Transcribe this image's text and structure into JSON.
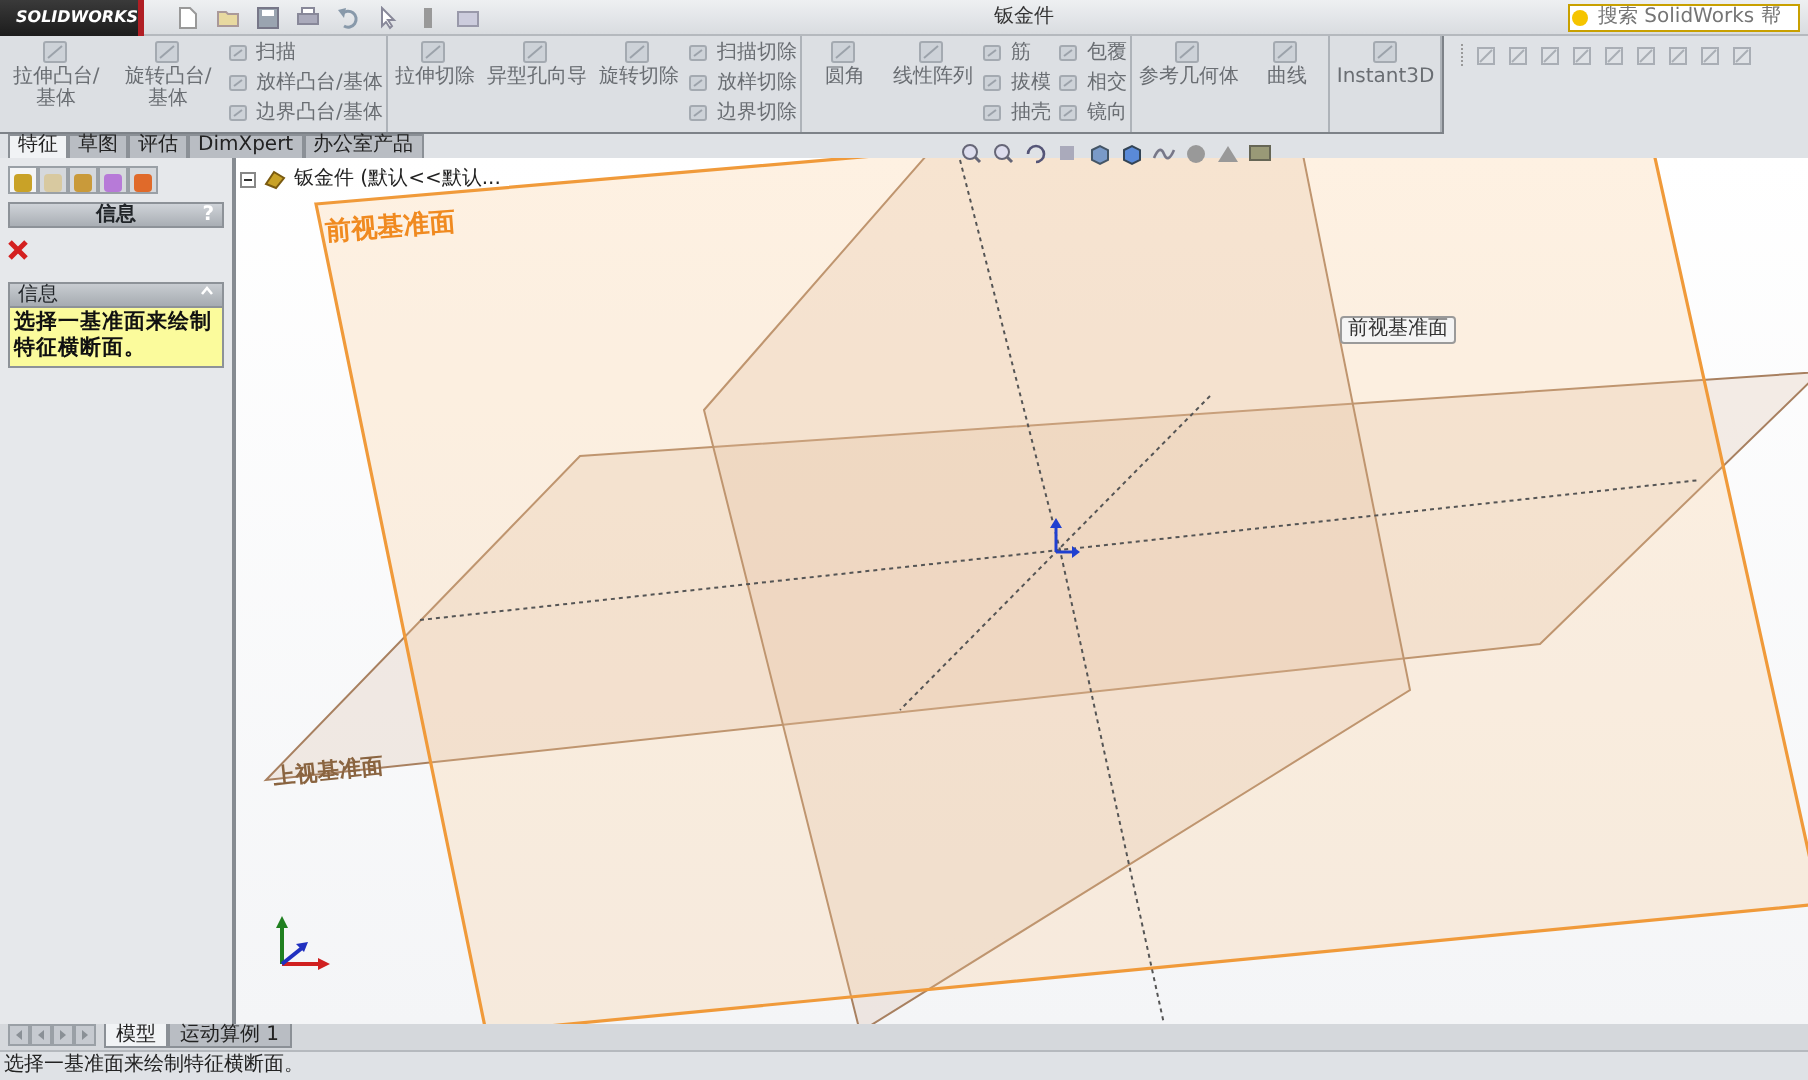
{
  "title_bar": {
    "logo": "SOLIDWORKS",
    "title": "钣金件",
    "search_placeholder": "搜索 SolidWorks 帮"
  },
  "ribbon": {
    "groups": [
      {
        "items": [
          {
            "label": "拉伸凸台/基体",
            "kind": "large"
          },
          {
            "label": "旋转凸台/基体",
            "kind": "large"
          },
          {
            "label": "扫描",
            "kind": "small"
          },
          {
            "label": "放样凸台/基体",
            "kind": "small"
          },
          {
            "label": "边界凸台/基体",
            "kind": "small"
          }
        ]
      },
      {
        "items": [
          {
            "label": "拉伸切除",
            "kind": "large"
          },
          {
            "label": "异型孔向导",
            "kind": "large"
          },
          {
            "label": "旋转切除",
            "kind": "large"
          },
          {
            "label": "扫描切除",
            "kind": "small"
          },
          {
            "label": "放样切除",
            "kind": "small"
          },
          {
            "label": "边界切除",
            "kind": "small"
          }
        ]
      },
      {
        "items": [
          {
            "label": "圆角",
            "kind": "large"
          },
          {
            "label": "线性阵列",
            "kind": "large"
          },
          {
            "label": "筋",
            "kind": "small"
          },
          {
            "label": "拔模",
            "kind": "small"
          },
          {
            "label": "抽壳",
            "kind": "small"
          },
          {
            "label": "包覆",
            "kind": "small"
          },
          {
            "label": "相交",
            "kind": "small"
          },
          {
            "label": "镜向",
            "kind": "small"
          }
        ]
      },
      {
        "items": [
          {
            "label": "参考几何体",
            "kind": "large"
          },
          {
            "label": "曲线",
            "kind": "large"
          }
        ]
      },
      {
        "items": [
          {
            "label": "Instant3D",
            "kind": "large"
          }
        ]
      }
    ]
  },
  "command_tabs": [
    {
      "label": "特征",
      "selected": true
    },
    {
      "label": "草图",
      "selected": false
    },
    {
      "label": "评估",
      "selected": false
    },
    {
      "label": "DimXpert",
      "selected": false
    },
    {
      "label": "办公室产品",
      "selected": false
    }
  ],
  "panel_tabs": [
    {
      "selected": true
    },
    {
      "selected": false
    },
    {
      "selected": false
    },
    {
      "selected": false
    },
    {
      "selected": false
    }
  ],
  "property_manager": {
    "title": "信息",
    "help": "?",
    "section": {
      "title": "信息",
      "message": "选择一基准面来绘制特征横断面。"
    }
  },
  "viewport": {
    "tree_root": "钣金件 (默认<<默认...",
    "tooltip": "前视基准面",
    "planes": [
      {
        "kind": "front",
        "label": "前视基准面",
        "highlighted": true
      },
      {
        "kind": "top",
        "label": "上视基准面",
        "highlighted": false
      },
      {
        "kind": "right",
        "highlighted": false
      }
    ]
  },
  "bottom_tabs": [
    {
      "label": "模型",
      "selected": true
    },
    {
      "label": "运动算例 1",
      "selected": false
    }
  ],
  "status_bar": "选择一基准面来绘制特征横断面。"
}
